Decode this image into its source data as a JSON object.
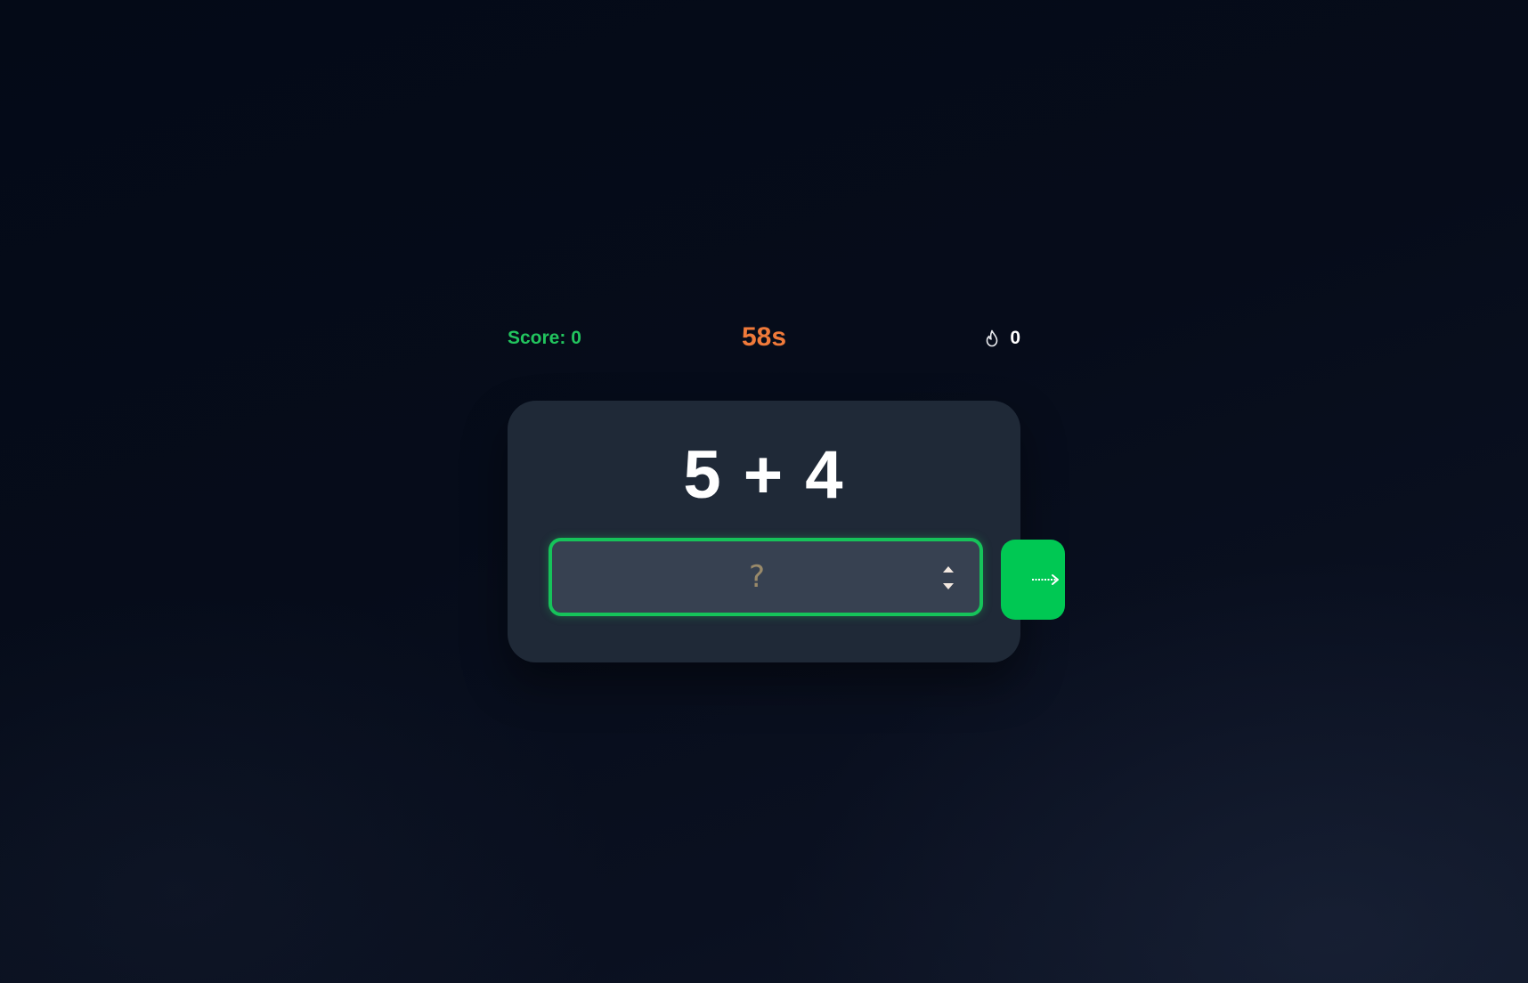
{
  "hud": {
    "score_text": "Score: 0",
    "timer_text": "58s",
    "streak_icon": "flame-icon",
    "streak_value": "0"
  },
  "problem": {
    "question": "5 + 4"
  },
  "answer": {
    "placeholder": "?",
    "value": ""
  },
  "submit": {
    "icon": "arrow-right-icon"
  },
  "colors": {
    "score": "#22c55e",
    "timer": "#f07a3a",
    "card": "#1f2937",
    "input": "#374151",
    "accent": "#00c853"
  }
}
